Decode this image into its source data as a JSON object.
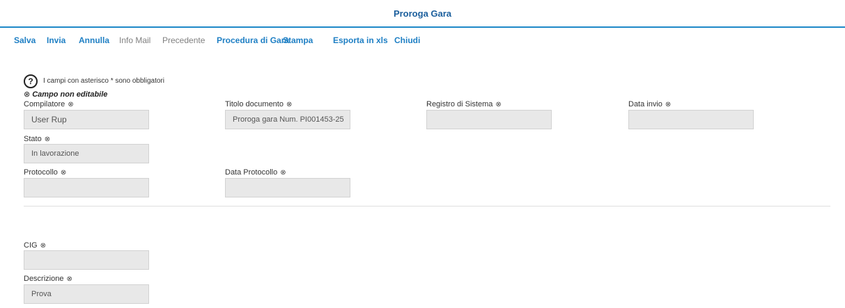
{
  "window": {
    "title": "Proroga Gara"
  },
  "toolbar": {
    "salva": "Salva",
    "invia": "Invia",
    "annulla": "Annulla",
    "info_mail": "Info Mail",
    "precedente": "Precedente",
    "procedura": "Procedura di Gara",
    "stampa": "Stampa",
    "esporta": "Esporta in xls",
    "chiudi": "Chiudi"
  },
  "help": {
    "icon": "?",
    "text": "I campi con asterisco * sono obbligatori",
    "not_editable_symbol": "⊗",
    "not_editable_text": "Campo non editabile"
  },
  "form": {
    "compilatore": {
      "label": "Compilatore",
      "value": "User Rup"
    },
    "titolo": {
      "label": "Titolo documento",
      "value": "Proroga gara Num. PI001453-25"
    },
    "registro": {
      "label": "Registro di Sistema",
      "value": ""
    },
    "data_invio": {
      "label": "Data invio",
      "value": ""
    },
    "stato": {
      "label": "Stato",
      "value": "In lavorazione"
    },
    "protocollo": {
      "label": "Protocollo",
      "value": ""
    },
    "data_protocollo": {
      "label": "Data Protocollo",
      "value": ""
    },
    "cig": {
      "label": "CIG",
      "value": ""
    },
    "descrizione": {
      "label": "Descrizione",
      "value": "Prova"
    }
  },
  "icons": {
    "not_editable": "⊗"
  },
  "colors": {
    "accent": "#1e7fc4",
    "title": "#1a5e9c",
    "field_bg": "#e8e8e8"
  }
}
